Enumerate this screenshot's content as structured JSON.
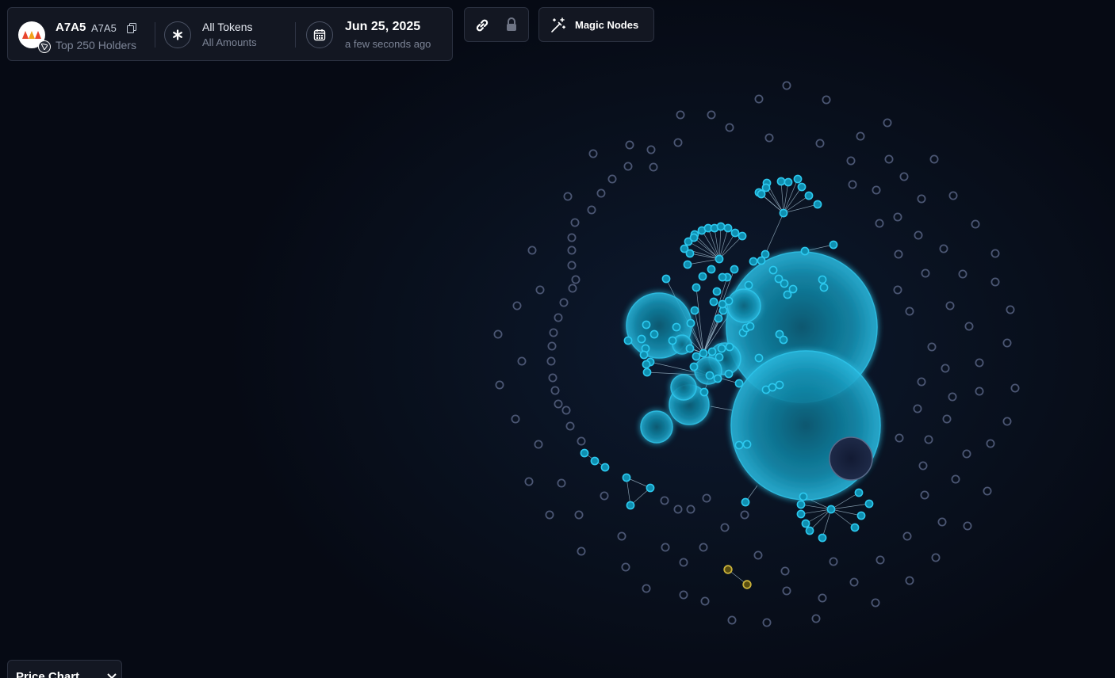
{
  "token": {
    "symbol": "A7A5",
    "name": "A7A5",
    "subtitle": "Top 250 Holders",
    "logo_icon": "a7a5-token-logo",
    "chain_icon": "tron-chain-icon"
  },
  "filter": {
    "title": "All Tokens",
    "subtitle": "All Amounts",
    "icon": "asterisk-icon"
  },
  "date": {
    "title": "Jun 25, 2025",
    "subtitle": "a few seconds ago",
    "icon": "calendar-icon"
  },
  "toolbar": {
    "link_icon": "link-icon",
    "lock_icon": "lock-icon",
    "magic_label": "Magic Nodes",
    "magic_icon": "magic-wand-icon"
  },
  "bottom": {
    "price_chart_label": "Price Chart",
    "price_chart_icon": "chevron-down-icon"
  },
  "graph": {
    "palette": {
      "background": "#070b17",
      "node_fill": "#0f8fb0",
      "node_stroke": "#2cc8ee",
      "dim_node": "#4b5673",
      "highlight": "#c9b13a",
      "dark_bubble": "#1a2540"
    }
  }
}
